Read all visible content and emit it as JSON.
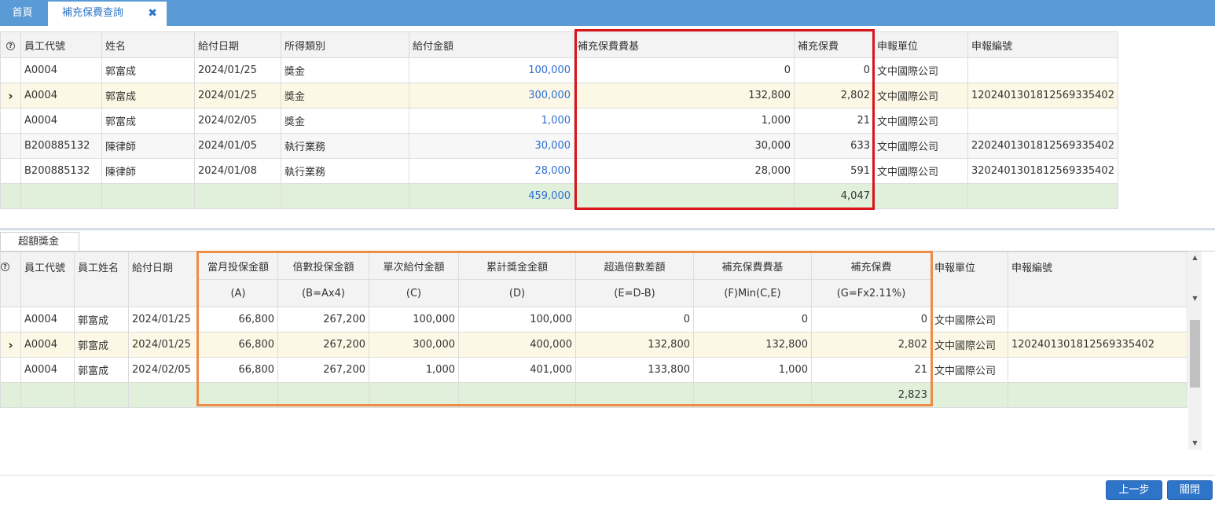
{
  "tabs": {
    "home": "首頁",
    "active": "補充保費查詢",
    "close_glyph": "✖"
  },
  "help_glyph": "?",
  "selected_marker": "›",
  "upper_grid": {
    "headers": [
      "員工代號",
      "姓名",
      "給付日期",
      "所得類別",
      "給付金額",
      "補充保費費基",
      "補充保費",
      "申報單位",
      "申報編號"
    ],
    "rows": [
      [
        "A0004",
        "郭富成",
        "2024/01/25",
        "獎金",
        "100,000",
        "0",
        "0",
        "文中國際公司",
        ""
      ],
      [
        "A0004",
        "郭富成",
        "2024/01/25",
        "獎金",
        "300,000",
        "132,800",
        "2,802",
        "文中國際公司",
        "1202401301812569335402"
      ],
      [
        "A0004",
        "郭富成",
        "2024/02/05",
        "獎金",
        "1,000",
        "1,000",
        "21",
        "文中國際公司",
        ""
      ],
      [
        "B200885132",
        "陳律師",
        "2024/01/05",
        "執行業務",
        "30,000",
        "30,000",
        "633",
        "文中國際公司",
        "2202401301812569335402"
      ],
      [
        "B200885132",
        "陳律師",
        "2024/01/08",
        "執行業務",
        "28,000",
        "28,000",
        "591",
        "文中國際公司",
        "3202401301812569335402"
      ]
    ],
    "totals": {
      "amount": "459,000",
      "premium": "4,047"
    }
  },
  "lower_tab": "超額獎金",
  "lower_grid": {
    "headers": [
      "員工代號",
      "員工姓名",
      "給付日期",
      "當月投保金額",
      "倍數投保金額",
      "單次給付金額",
      "累計獎金金額",
      "超過倍數差額",
      "補充保費費基",
      "補充保費",
      "申報單位",
      "申報編號"
    ],
    "subheaders": [
      "(A)",
      "(B=Ax4)",
      "(C)",
      "(D)",
      "(E=D-B)",
      "(F)Min(C,E)",
      "(G=Fx2.11%)"
    ],
    "rows": [
      [
        "A0004",
        "郭富成",
        "2024/01/25",
        "66,800",
        "267,200",
        "100,000",
        "100,000",
        "0",
        "0",
        "0",
        "文中國際公司",
        ""
      ],
      [
        "A0004",
        "郭富成",
        "2024/01/25",
        "66,800",
        "267,200",
        "300,000",
        "400,000",
        "132,800",
        "132,800",
        "2,802",
        "文中國際公司",
        "1202401301812569335402"
      ],
      [
        "A0004",
        "郭富成",
        "2024/02/05",
        "66,800",
        "267,200",
        "1,000",
        "401,000",
        "133,800",
        "1,000",
        "21",
        "文中國際公司",
        ""
      ]
    ],
    "totals": {
      "premium": "2,823"
    }
  },
  "buttons": {
    "prev": "上一步",
    "close": "關閉"
  },
  "colors": {
    "topbar": "#5b9bd5",
    "highlight_red": "#d9141b",
    "highlight_orange": "#ef8a47",
    "link_blue": "#2e6fd6",
    "sum_row": "#e1f0da",
    "selected_row": "#fdf8e6",
    "button": "#2e75c9"
  }
}
